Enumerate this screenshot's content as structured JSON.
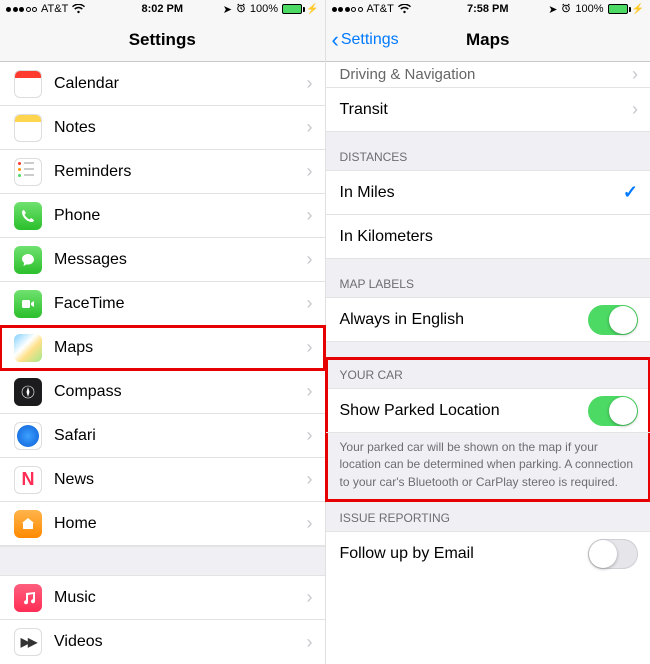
{
  "left": {
    "status": {
      "carrier": "AT&T",
      "time": "8:02 PM",
      "battery": "100%"
    },
    "title": "Settings",
    "items": [
      {
        "label": "Calendar"
      },
      {
        "label": "Notes"
      },
      {
        "label": "Reminders"
      },
      {
        "label": "Phone"
      },
      {
        "label": "Messages"
      },
      {
        "label": "FaceTime"
      },
      {
        "label": "Maps"
      },
      {
        "label": "Compass"
      },
      {
        "label": "Safari"
      },
      {
        "label": "News"
      },
      {
        "label": "Home"
      }
    ],
    "items2": [
      {
        "label": "Music"
      },
      {
        "label": "Videos"
      }
    ]
  },
  "right": {
    "status": {
      "carrier": "AT&T",
      "time": "7:58 PM",
      "battery": "100%"
    },
    "back": "Settings",
    "title": "Maps",
    "clipped_rows": [
      {
        "label": "Driving & Navigation"
      },
      {
        "label": "Transit"
      }
    ],
    "sections": {
      "distances": {
        "header": "DISTANCES",
        "rows": [
          {
            "label": "In Miles",
            "selected": true
          },
          {
            "label": "In Kilometers",
            "selected": false
          }
        ]
      },
      "map_labels": {
        "header": "MAP LABELS",
        "row": {
          "label": "Always in English",
          "on": true
        }
      },
      "your_car": {
        "header": "YOUR CAR",
        "row": {
          "label": "Show Parked Location",
          "on": true
        },
        "footer": "Your parked car will be shown on the map if your location can be determined when parking. A connection to your car's Bluetooth or CarPlay stereo is required."
      },
      "issue": {
        "header": "ISSUE REPORTING",
        "row": {
          "label": "Follow up by Email",
          "on": false
        }
      }
    }
  }
}
